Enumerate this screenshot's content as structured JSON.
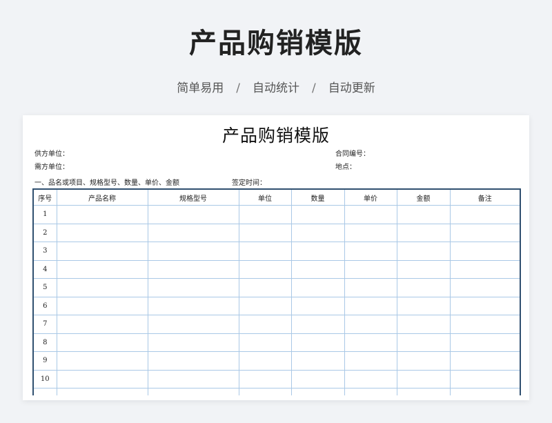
{
  "hero": {
    "title": "产品购销模版",
    "subtitle": [
      "简单易用",
      "自动统计",
      "自动更新"
    ],
    "separator": "/"
  },
  "document": {
    "title": "产品购销模版",
    "supplier_label": "供方单位：",
    "buyer_label": "需方单位：",
    "contract_no_label": "合同编号：",
    "location_label": "地点：",
    "section_label": "一、品名或项目、规格型号、数量、单价、金额",
    "sign_time_label": "签定时间：",
    "columns": [
      "序号",
      "产品名称",
      "规格型号",
      "单位",
      "数量",
      "单价",
      "金额",
      "备注"
    ],
    "rows": [
      "1",
      "2",
      "3",
      "4",
      "5",
      "6",
      "7",
      "8",
      "9",
      "10"
    ]
  }
}
